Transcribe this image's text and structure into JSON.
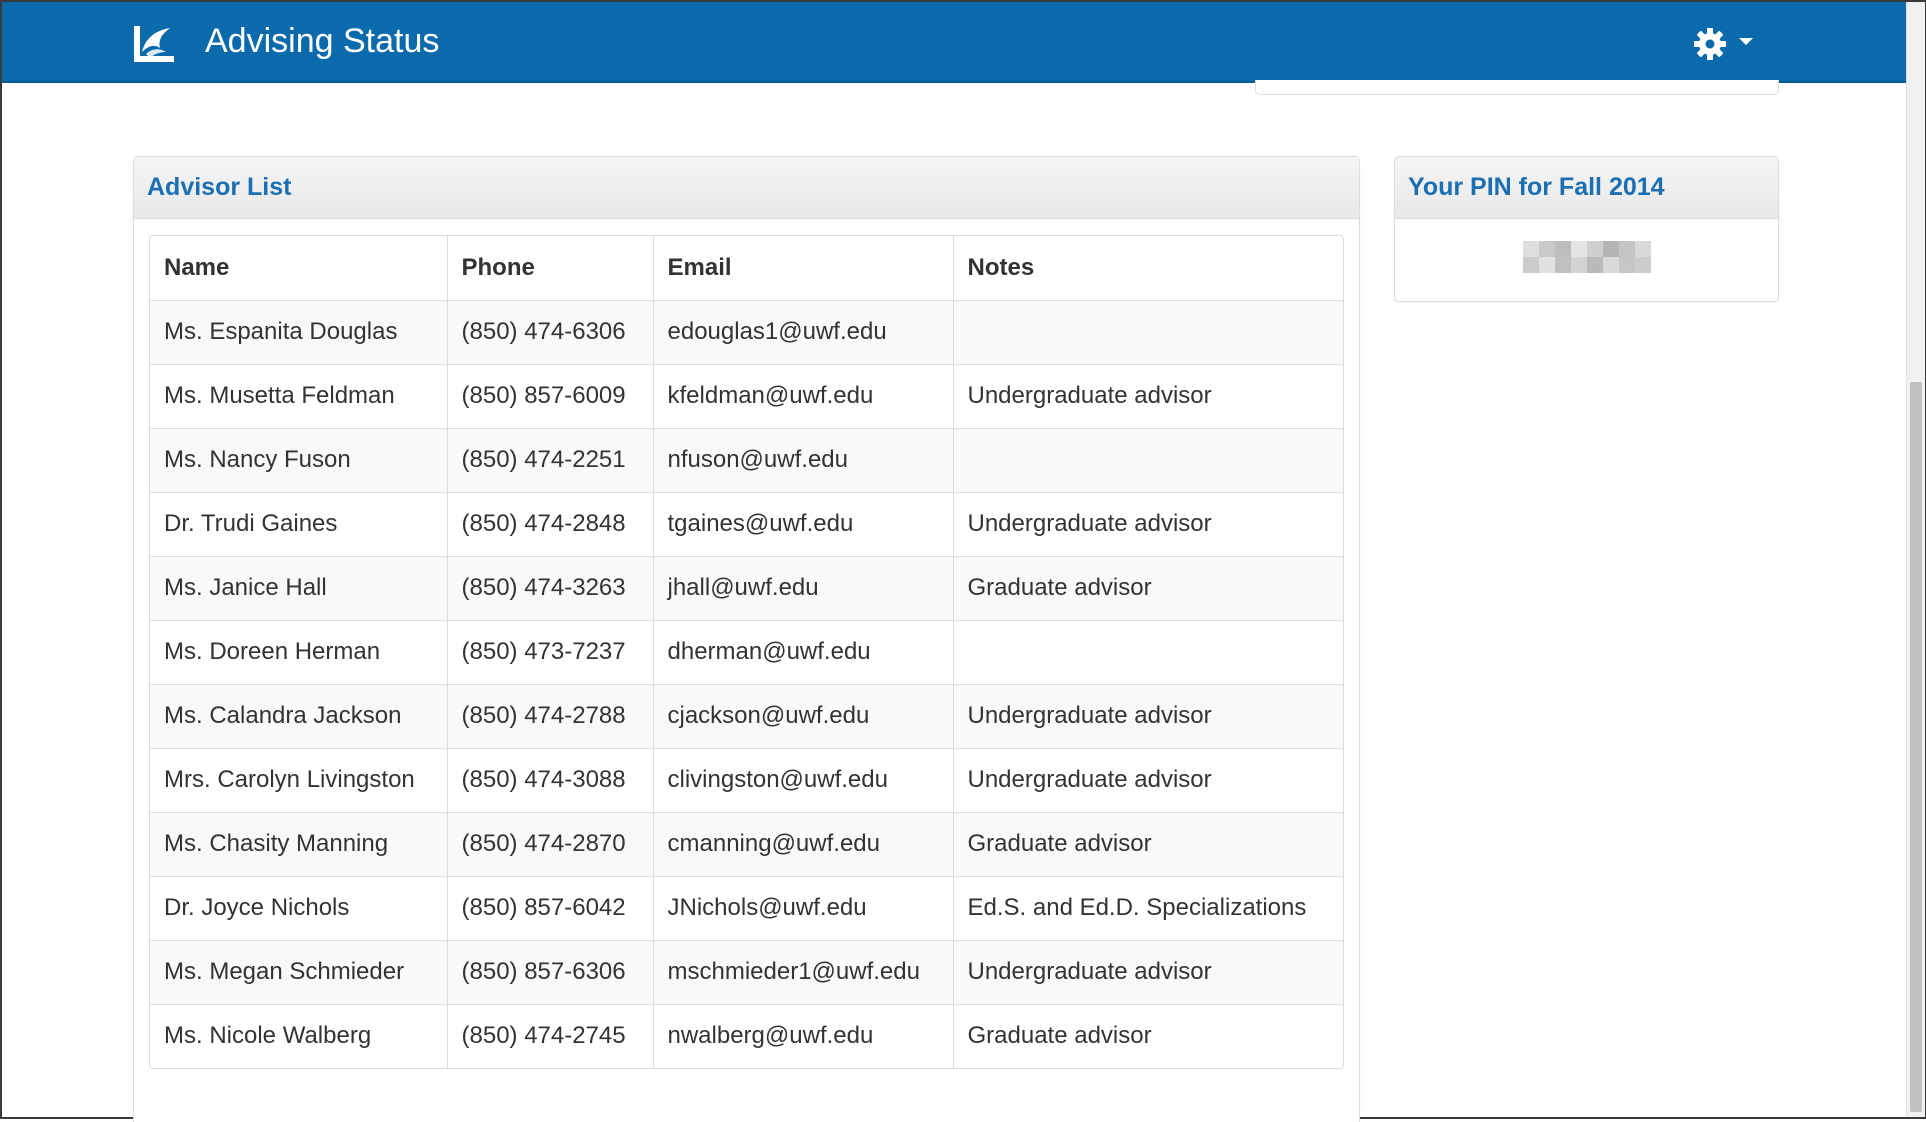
{
  "app": {
    "title": "Advising Status"
  },
  "header": {
    "settings_icon": "gear-icon",
    "menu_icon": "caret-down-icon",
    "logo_icon": "uwf-logo-icon"
  },
  "colors": {
    "navbar": "#0a6aab",
    "panel_title": "#1c6fb0"
  },
  "advisor_panel": {
    "title": "Advisor List",
    "columns": [
      "Name",
      "Phone",
      "Email",
      "Notes"
    ],
    "rows": [
      {
        "name": "Ms. Espanita Douglas",
        "phone": "(850) 474-6306",
        "email": "edouglas1@uwf.edu",
        "notes": ""
      },
      {
        "name": "Ms. Musetta Feldman",
        "phone": "(850) 857-6009",
        "email": "kfeldman@uwf.edu",
        "notes": "Undergraduate advisor"
      },
      {
        "name": "Ms. Nancy Fuson",
        "phone": "(850) 474-2251",
        "email": "nfuson@uwf.edu",
        "notes": ""
      },
      {
        "name": "Dr. Trudi Gaines",
        "phone": "(850) 474-2848",
        "email": "tgaines@uwf.edu",
        "notes": "Undergraduate advisor"
      },
      {
        "name": "Ms. Janice Hall",
        "phone": "(850) 474-3263",
        "email": "jhall@uwf.edu",
        "notes": "Graduate advisor"
      },
      {
        "name": "Ms. Doreen Herman",
        "phone": "(850) 473-7237",
        "email": "dherman@uwf.edu",
        "notes": ""
      },
      {
        "name": "Ms. Calandra Jackson",
        "phone": "(850) 474-2788",
        "email": "cjackson@uwf.edu",
        "notes": "Undergraduate advisor"
      },
      {
        "name": "Mrs. Carolyn Livingston",
        "phone": "(850) 474-3088",
        "email": "clivingston@uwf.edu",
        "notes": "Undergraduate advisor"
      },
      {
        "name": "Ms. Chasity Manning",
        "phone": "(850) 474-2870",
        "email": "cmanning@uwf.edu",
        "notes": "Graduate advisor"
      },
      {
        "name": "Dr. Joyce Nichols",
        "phone": "(850) 857-6042",
        "email": "JNichols@uwf.edu",
        "notes": "Ed.S. and Ed.D. Specializations"
      },
      {
        "name": "Ms. Megan Schmieder",
        "phone": "(850) 857-6306",
        "email": "mschmieder1@uwf.edu",
        "notes": "Undergraduate advisor"
      },
      {
        "name": "Ms. Nicole Walberg",
        "phone": "(850) 474-2745",
        "email": "nwalberg@uwf.edu",
        "notes": "Graduate advisor"
      }
    ]
  },
  "pin_panel": {
    "title": "Your PIN for Fall 2014"
  }
}
